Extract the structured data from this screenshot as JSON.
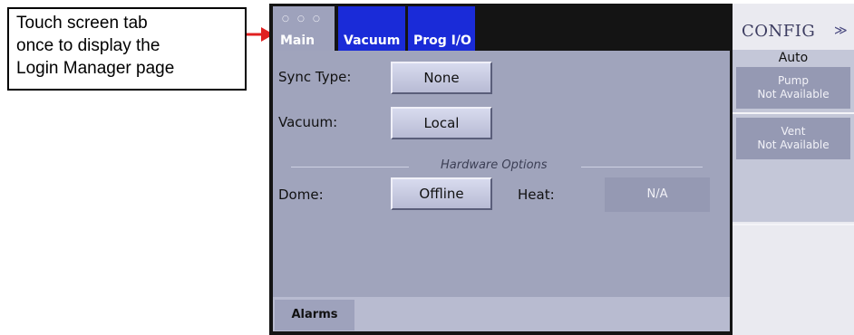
{
  "callout": {
    "lines": [
      "Touch screen tab",
      "once to display the",
      "Login Manager page"
    ]
  },
  "tabs": [
    {
      "label": "Main",
      "dots": "○ ○ ○"
    },
    {
      "label": "Vacuum"
    },
    {
      "label": "Prog I/O"
    }
  ],
  "main": {
    "sync_label": "Sync Type:",
    "sync_value": "None",
    "vacuum_label": "Vacuum:",
    "vacuum_value": "Local",
    "section_title": "Hardware Options",
    "dome_label": "Dome:",
    "dome_value": "Offline",
    "heat_label": "Heat:",
    "heat_value": "N/A",
    "alarms_label": "Alarms"
  },
  "side": {
    "title": "CONFIG",
    "chevron": "≫",
    "mode": "Auto",
    "items": [
      {
        "name": "Pump",
        "status": "Not Available"
      },
      {
        "name": "Vent",
        "status": "Not Available"
      }
    ]
  },
  "colors": {
    "active_tab": "#9ea2bc",
    "inactive_tab": "#1a2bd8",
    "panel_bg": "#a0a4bc",
    "callout_arrow": "#e02020"
  }
}
